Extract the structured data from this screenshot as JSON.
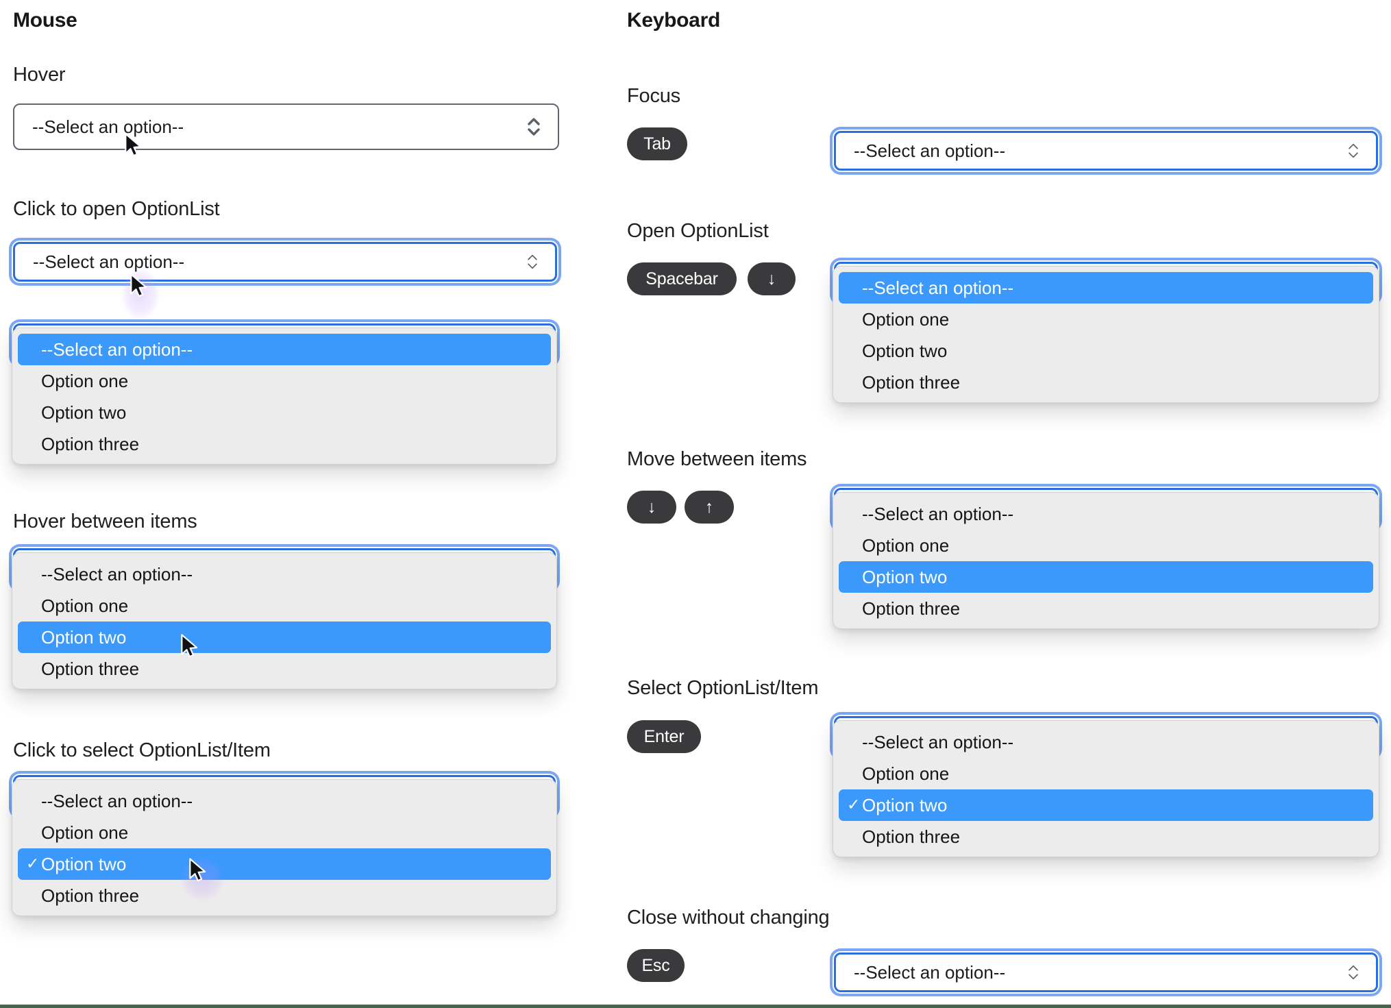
{
  "titles": {
    "mouse": "Mouse",
    "keyboard": "Keyboard"
  },
  "mouse_sections": {
    "hover": "Hover",
    "click_open": "Click to open OptionList",
    "hover_items": "Hover between items",
    "click_select": "Click to select OptionList/Item"
  },
  "keyboard_sections": {
    "focus": "Focus",
    "open": "Open OptionList",
    "move": "Move between items",
    "select": "Select OptionList/Item",
    "close": "Close without changing"
  },
  "keys": {
    "tab": "Tab",
    "spacebar": "Spacebar",
    "down": "↓",
    "up": "↑",
    "enter": "Enter",
    "esc": "Esc"
  },
  "select": {
    "placeholder": "--Select an option--"
  },
  "options": {
    "placeholder": "--Select an option--",
    "one": "Option one",
    "two": "Option two",
    "three": "Option three"
  },
  "check": "✓",
  "icons": {
    "select_chevron": "up-down-chevron",
    "cursor": "arrow-cursor",
    "keyboard_down": "↓",
    "keyboard_up": "↑"
  },
  "colors": {
    "highlight_blue": "#3b99fc",
    "focus_border": "#2a6fe0",
    "focus_ring": "#7ba6f4",
    "list_background": "#ececec",
    "select_border_gray": "#606570",
    "key_badge_background": "#3a3a3c",
    "bottom_rule_green": "#46654d"
  }
}
